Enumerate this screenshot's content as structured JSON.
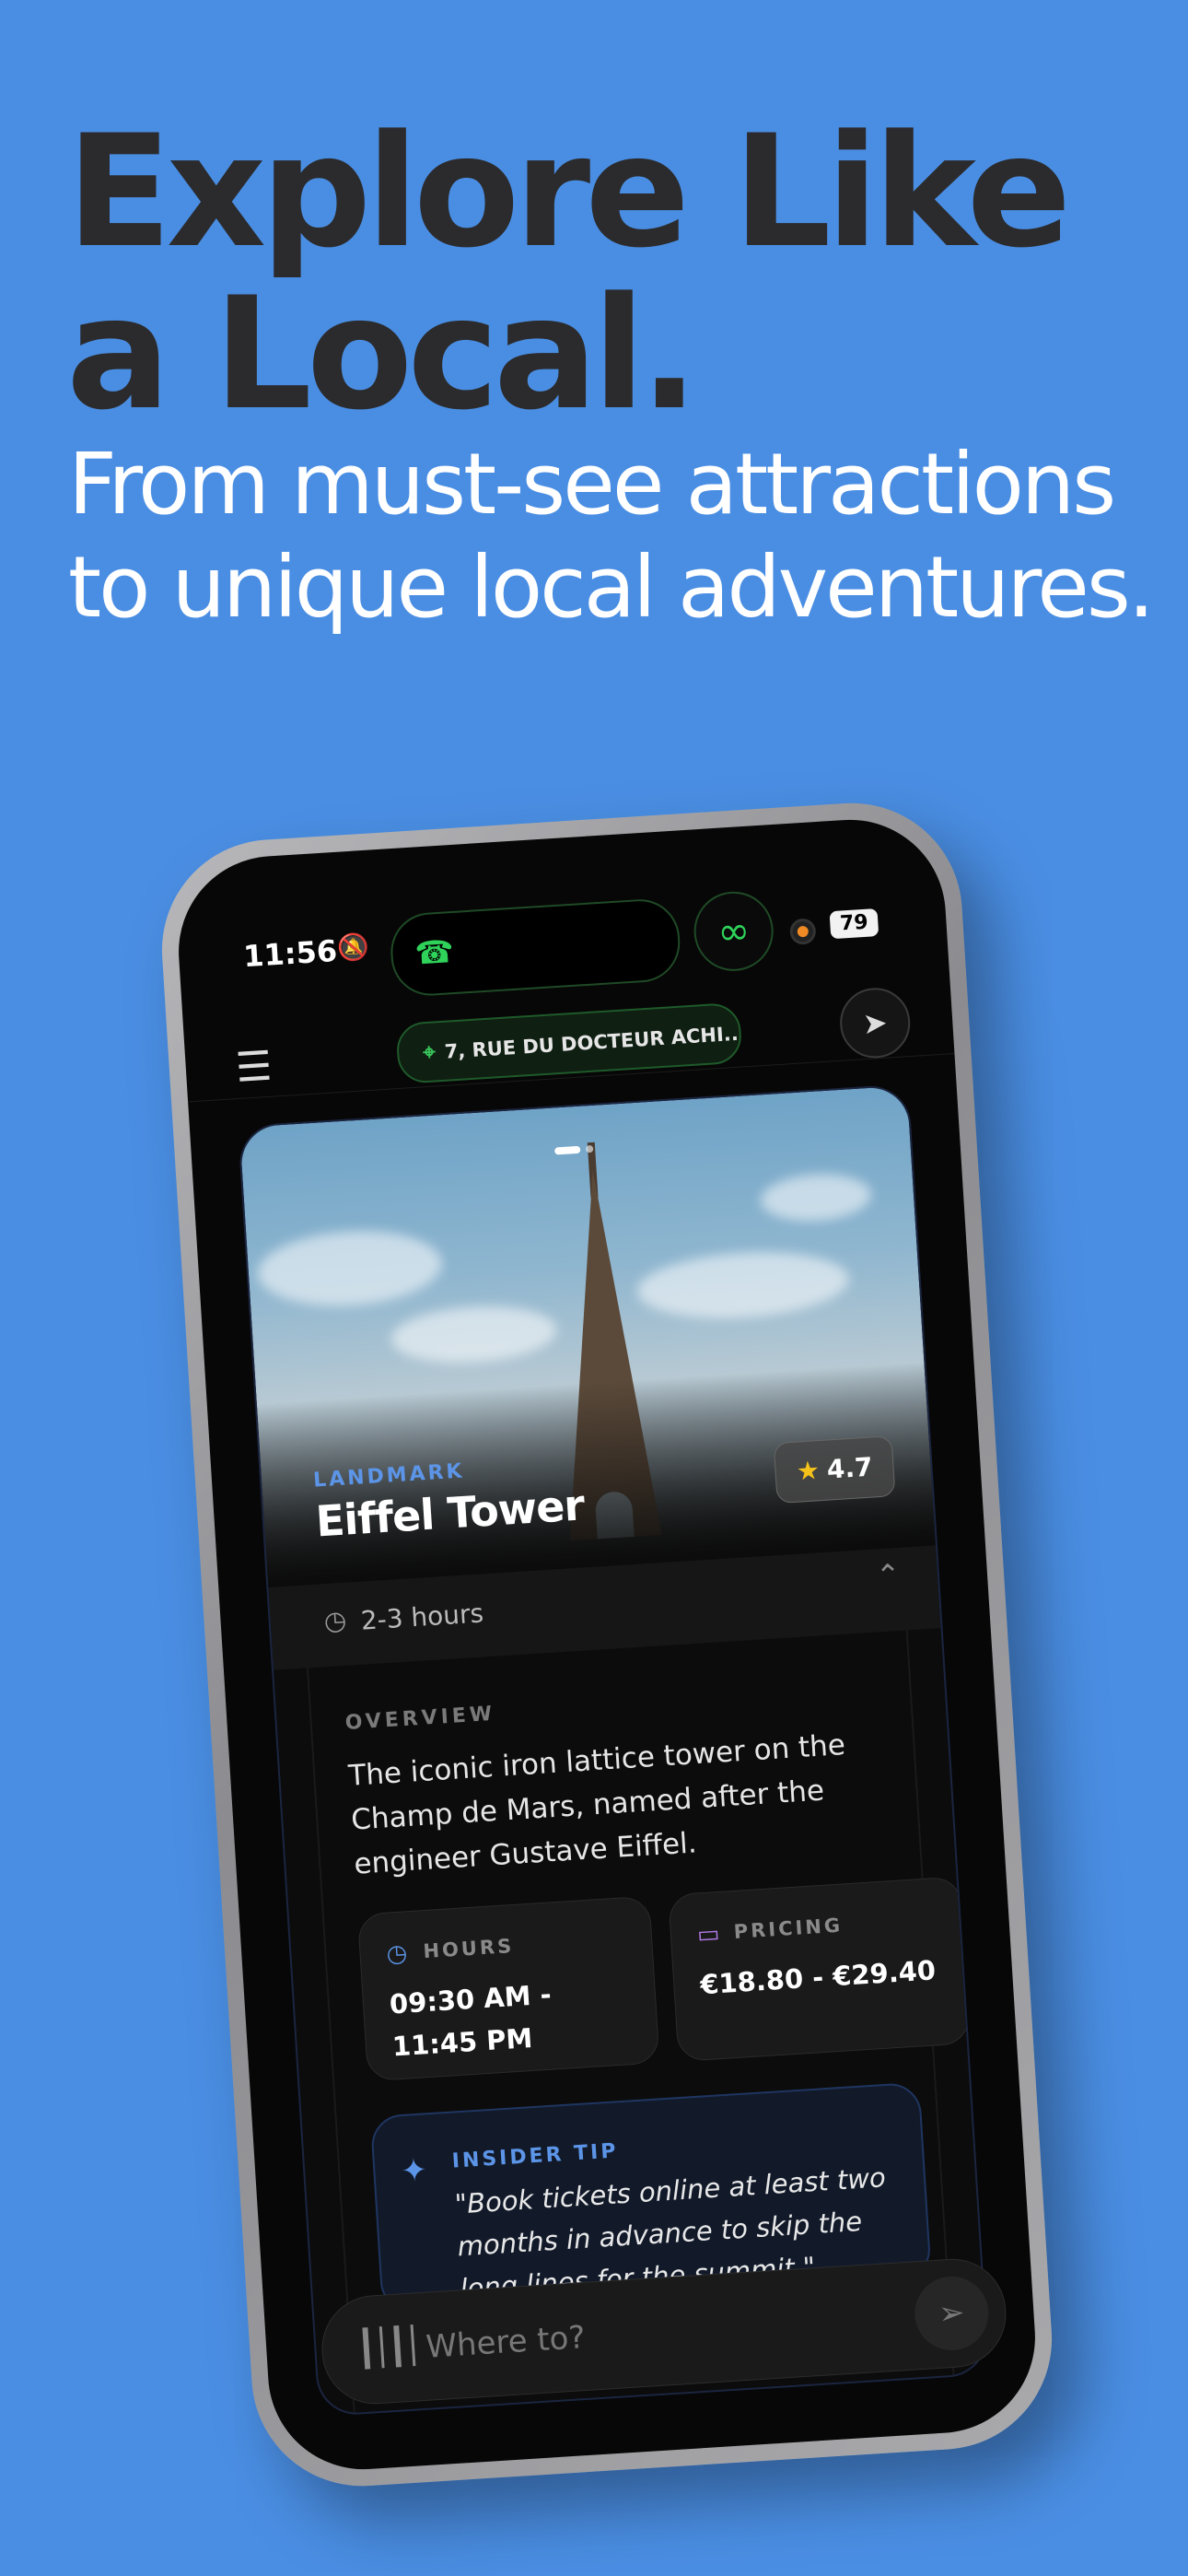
{
  "headline": "Explore Like a Local.",
  "subheadline": "From must-see attractions to unique local adventures.",
  "status_bar": {
    "time": "11:56",
    "battery": "79"
  },
  "top_bar": {
    "address": "7, RUE DU DOCTEUR ACHI..."
  },
  "place": {
    "category": "LANDMARK",
    "name": "Eiffel Tower",
    "rating": "4.7",
    "duration": "2-3 hours",
    "overview_label": "OVERVIEW",
    "overview": "The iconic iron lattice tower on the Champ de Mars, named after the engineer Gustave Eiffel.",
    "hours_label": "HOURS",
    "hours": "09:30 AM - 11:45 PM",
    "pricing_label": "PRICING",
    "pricing": "€18.80 - €29.40",
    "tip_label": "INSIDER TIP",
    "tip": "\"Book tickets online at least two months in advance to skip the long lines for the summit.\""
  },
  "search": {
    "placeholder": "Where to?"
  },
  "colors": {
    "background": "#4a8ee3",
    "accent_blue": "#5c95e8",
    "accent_green": "#2fd35a",
    "star": "#f4c21a",
    "pricing_icon": "#b27be8"
  },
  "icons": [
    "bell-slash-icon",
    "phone-icon",
    "link-icon",
    "menu-icon",
    "location-pin-icon",
    "compass-icon",
    "star-icon",
    "clock-icon",
    "chevron-up-icon",
    "credit-card-icon",
    "sparkle-icon",
    "waveform-icon",
    "send-icon"
  ]
}
